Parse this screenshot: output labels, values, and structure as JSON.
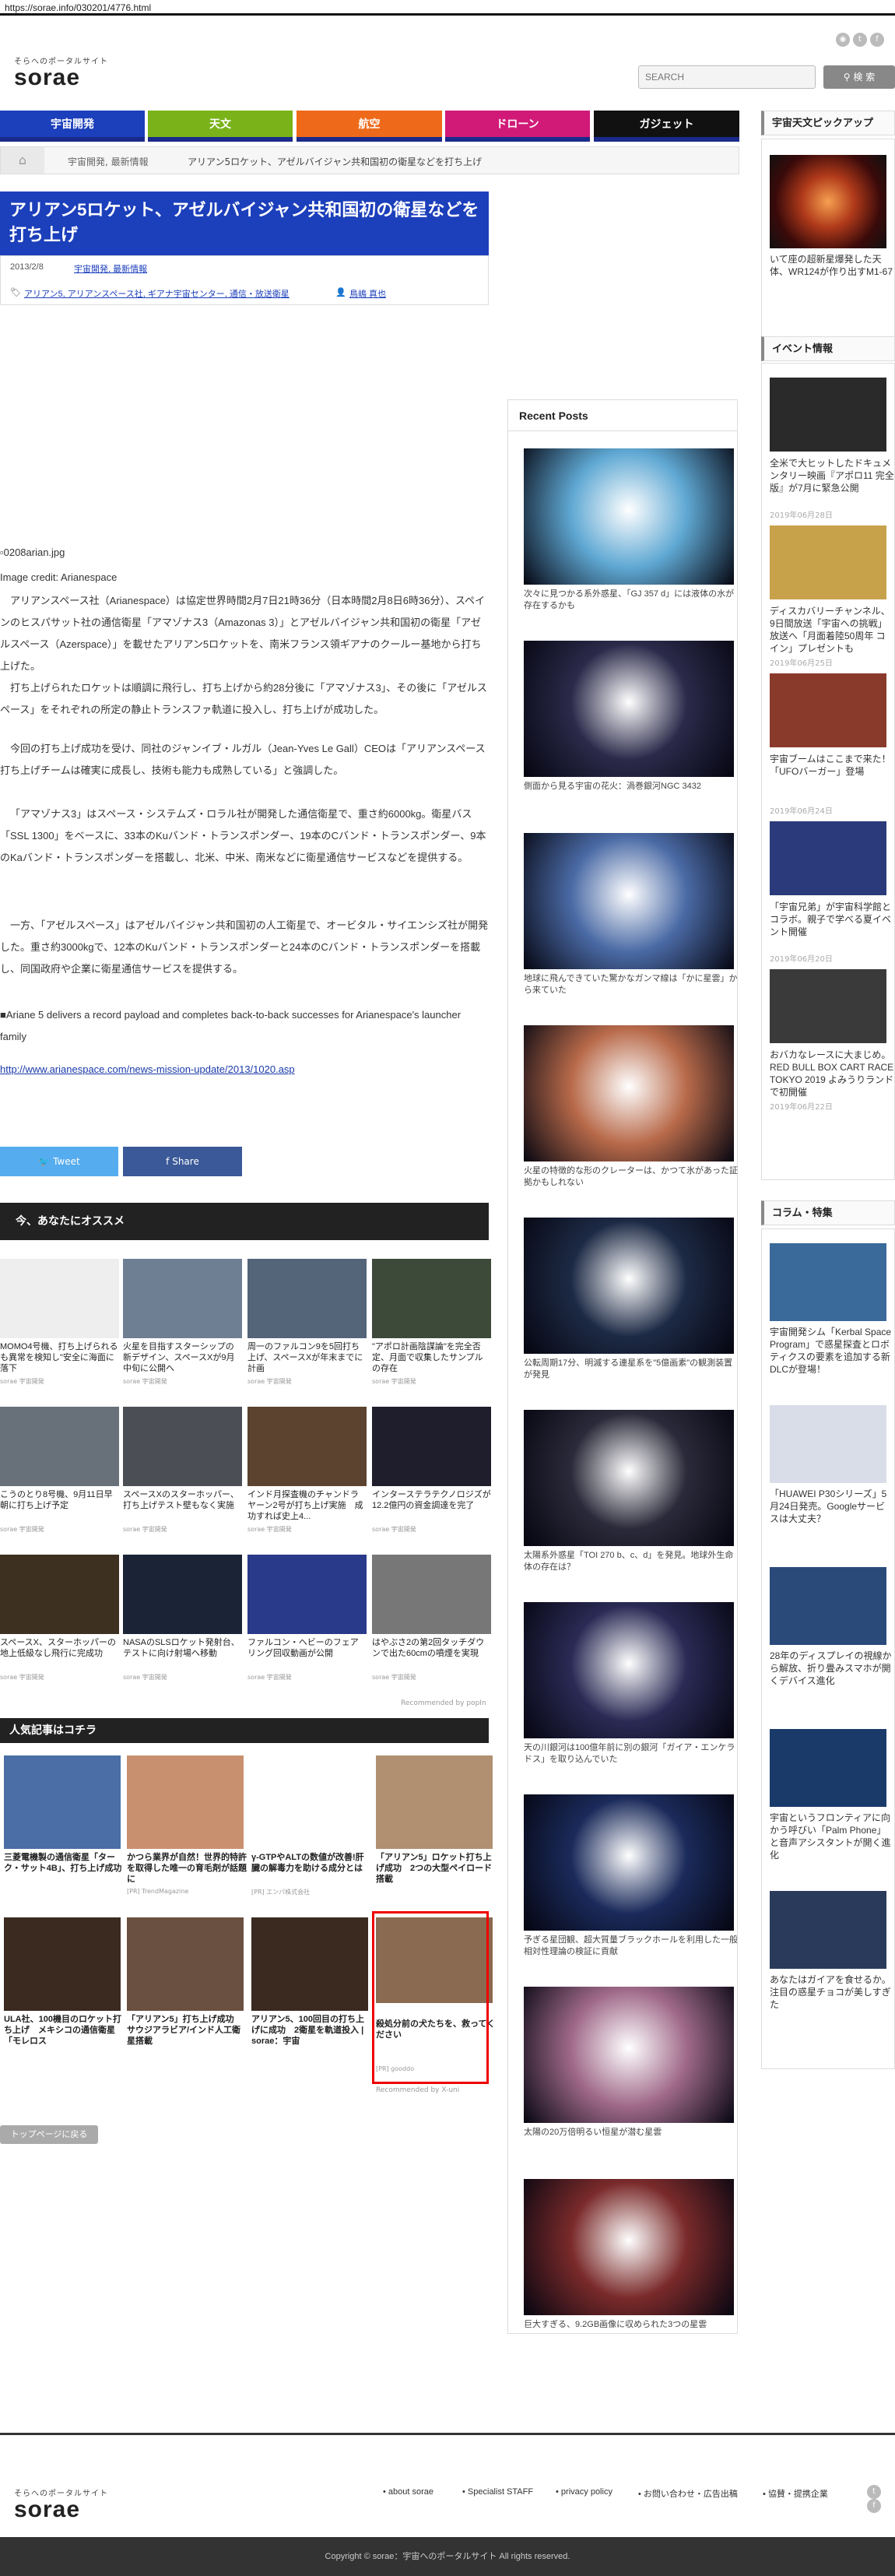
{
  "url": "https://sorae.info/030201/4776.html",
  "header": {
    "logo_small": "そらへのポータルサイト",
    "logo_big": "sorae",
    "search_placeholder": "SEARCH",
    "search_button": "検 索"
  },
  "nav": [
    {
      "label": "宇宙開発",
      "color": "#1c3fbb"
    },
    {
      "label": "天文",
      "color": "#7ab319"
    },
    {
      "label": "航空",
      "color": "#ee6a1a"
    },
    {
      "label": "ドローン",
      "color": "#d11a78"
    },
    {
      "label": "ガジェット",
      "color": "#111111"
    }
  ],
  "breadcrumb": {
    "cat": "宇宙開発, 最新情報",
    "current": "アリアン5ロケット、アゼルバイジャン共和国初の衛星などを打ち上げ"
  },
  "article": {
    "title": "アリアン5ロケット、アゼルバイジャン共和国初の衛星などを打ち上げ",
    "date": "2013/2/8",
    "categories": "宇宙開発, 最新情報",
    "tags": "アリアン5, アリアンスペース社, ギアナ宇宙センター, 通信・放送衛星",
    "author": "鳥嶋 真也",
    "img_alt": "0208arian.jpg",
    "credit": "Image credit: Arianespace",
    "p1": "アリアンスペース社（Arianespace）は協定世界時間2月7日21時36分（日本時間2月8日6時36分）、スペインのヒスパサット社の通信衛星「アマゾナス3（Amazonas 3）」とアゼルバイジャン共和国初の衛星「アゼルスペース（Azerspace）」を載せたアリアン5ロケットを、南米フランス領ギアナのクールー基地から打ち上げた。",
    "p2": "打ち上げられたロケットは順調に飛行し、打ち上げから約28分後に「アマゾナス3」、その後に「アゼルスペース」をそれぞれの所定の静止トランスファ軌道に投入し、打ち上げが成功した。",
    "p3": "今回の打ち上げ成功を受け、同社のジャンイブ・ルガル（Jean-Yves Le Gall）CEOは「アリアンスペース打ち上げチームは確実に成長し、技術も能力も成熟している」と強調した。",
    "p4": "「アマゾナス3」はスペース・システムズ・ロラル社が開発した通信衛星で、重さ約6000kg。衛星バス「SSL 1300」をベースに、33本のKuバンド・トランスポンダー、19本のCバンド・トランスポンダー、9本のKaバンド・トランスポンダーを搭載し、北米、中米、南米などに衛星通信サービスなどを提供する。",
    "p5": "一方、「アゼルスペース」はアゼルバイジャン共和国初の人工衛星で、オービタル・サイエンシズ社が開発した。重さ約3000kgで、12本のKuバンド・トランスポンダーと24本のCバンド・トランスポンダーを搭載し、同国政府や企業に衛星通信サービスを提供する。",
    "source": "■Ariane 5 delivers a record payload and completes back-to-back successes for Arianespace's launcher family",
    "link": "http://www.arianespace.com/news-mission-update/2013/1020.asp"
  },
  "share": {
    "tweet": "Tweet",
    "share": "Share"
  },
  "recommend": {
    "heading": "今、あなたにオススメ",
    "footer": "Recommended by",
    "brand": "popIn",
    "items": [
      {
        "title": "MOMO4号機、打ち上げられるも異常を検知し\"安全に海面に落下",
        "source": "sorae 宇宙開発",
        "bg": "#eeeeee"
      },
      {
        "title": "火星を目指すスターシップの新デザイン、スペースXが9月中旬に公開へ",
        "source": "sorae 宇宙開発",
        "bg": "#6e7f93"
      },
      {
        "title": "周一のファルコン9を5回打ち上げ、スペースXが年末までに計画",
        "source": "sorae 宇宙開発",
        "bg": "#54657a"
      },
      {
        "title": "\"アポロ計画陰謀論\"を完全否定、月面で収集したサンプルの存在",
        "source": "sorae 宇宙開発",
        "bg": "#3d4a3a"
      },
      {
        "title": "こうのとり8号機、9月11日早朝に打ち上げ予定",
        "source": "sorae 宇宙開発",
        "bg": "#68707a"
      },
      {
        "title": "スペースXのスターホッパー、打ち上げテスト壁もなく実施",
        "source": "sorae 宇宙開発",
        "bg": "#4b4f55"
      },
      {
        "title": "インド月探査機のチャンドラヤーン2号が打ち上げ実施　成功すれば史上4...",
        "source": "sorae 宇宙開発",
        "bg": "#5b4330"
      },
      {
        "title": "インターステラテクノロジズが12.2億円の資金調達を完了",
        "source": "sorae 宇宙開発",
        "bg": "#1e1e2c"
      },
      {
        "title": "スペースX、スターホッパーの地上低級なし飛行に完成功",
        "source": "sorae 宇宙開発",
        "bg": "#3d3020"
      },
      {
        "title": "NASAのSLSロケット発射台、テストに向け射場へ移動",
        "source": "sorae 宇宙開発",
        "bg": "#1b2436"
      },
      {
        "title": "ファルコン・ヘビーのフェアリング回収動画が公開",
        "source": "sorae 宇宙開発",
        "bg": "#2a3a8a"
      },
      {
        "title": "はやぶさ2の第2回タッチダウンで出た60cmの噴煙を実現",
        "source": "sorae 宇宙開発",
        "bg": "#777777"
      }
    ]
  },
  "popular": {
    "heading": "人気記事はコチラ",
    "footer": "Recommended by",
    "brand": "X-uni",
    "items": [
      {
        "title": "三菱電機製の通信衛星「ターク・サット4B」、打ち上げ成功",
        "source": "",
        "bg": "#4a6ea5"
      },
      {
        "title": "かつら業界が自然！世界的特許を取得した唯一の育毛剤が話題に",
        "source": "[PR] TrendMagazine",
        "bg": "#c99070"
      },
      {
        "title": "γ-GTPやALTの数値が改善!肝臓の解毒力を助ける成分とは",
        "source": "[PR] エンパ株式会社",
        "bg": "#ffffff"
      },
      {
        "title": "「アリアン5」ロケット打ち上げ成功　2つの大型ペイロード搭載",
        "source": "",
        "bg": "#b09070"
      },
      {
        "title": "ULA社、100機目のロケット打ち上げ　メキシコの通信衛星「モレロス",
        "source": "",
        "bg": "#3a2a20"
      },
      {
        "title": "「アリアン5」打ち上げ成功　サウジアラビア/インド人工衛星搭載",
        "source": "",
        "bg": "#6a5040"
      },
      {
        "title": "アリアン5、100回目の打ち上げに成功　2衛星を軌道投入 | sorae：宇宙",
        "source": "",
        "bg": "#3a2a20"
      },
      {
        "title": "殺処分前の犬たちを、救ってください",
        "source": "[PR] gooddo",
        "bg": "#8a6a50"
      }
    ]
  },
  "top_button": "トップページに戻る",
  "recent_posts": {
    "heading": "Recent Posts",
    "items": [
      {
        "title": "次々に見つかる系外惑星、「GJ 357 d」には液体の水が存在するかも",
        "bg": "#5fa8d3"
      },
      {
        "title": "側面から見る宇宙の花火：渦巻銀河NGC 3432",
        "bg": "#2b2a4a"
      },
      {
        "title": "地球に飛んできていた驚かなガンマ線は「かに星雲」から来ていた",
        "bg": "#4a6aa5"
      },
      {
        "title": "火星の特徴的な形のクレーターは、かつて氷があった証拠かもしれない",
        "bg": "#b86a4a"
      },
      {
        "title": "公転周期17分、明滅する連星系を\"5億画素\"の観測装置が発見",
        "bg": "#1d2a45"
      },
      {
        "title": "太陽系外惑星「TOI 270 b、c、d」を発見。地球外生命体の存在は？",
        "bg": "#2a2a3a"
      },
      {
        "title": "天の川銀河は100億年前に別の銀河「ガイア・エンケラドス」を取り込んでいた",
        "bg": "#2a2a55"
      },
      {
        "title": "予ぎる星団観、超大質量ブラックホールを利用した一般相対性理論の検証に貢献",
        "bg": "#1a2a5a"
      },
      {
        "title": "太陽の20万倍明るい恒星が潜む星雲",
        "bg": "#a06a8a"
      },
      {
        "title": "巨大すぎる、9.2GB画像に収められた3つの星雲",
        "bg": "#7a2a2a"
      }
    ]
  },
  "sidebar": {
    "pickup_heading": "宇宙天文ピックアップ",
    "pickup": {
      "title": "いて座の超新星爆発した天体、WR124が作り出すM1-67",
      "bg": "#7a2a1a"
    },
    "event_heading": "イベント情報",
    "events": [
      {
        "title": "全米で大ヒットしたドキュメンタリー映画『アポロ11 完全版』が7月に緊急公開",
        "date": "2019年06月28日",
        "bg": "#2a2a2a"
      },
      {
        "title": "ディスカバリーチャンネル、9日間放送「宇宙への挑戦」放送へ「月面着陸50周年 コイン」プレゼントも",
        "date": "2019年06月25日",
        "bg": "#c7a24a"
      },
      {
        "title": "宇宙ブームはここまで来た！「UFOバーガー」登場",
        "date": "2019年06月24日",
        "bg": "#8a3a2a"
      },
      {
        "title": "「宇宙兄弟」が宇宙科学館とコラボ。親子で学べる夏イベント開催",
        "date": "2019年06月20日",
        "bg": "#2a3a7a"
      },
      {
        "title": "おバカなレースに大まじめ。RED BULL BOX CART RACE TOKYO 2019 よみうりランドで初開催",
        "date": "2019年06月22日",
        "bg": "#3a3a3a"
      }
    ],
    "column_heading": "コラム・特集",
    "columns": [
      {
        "title": "宇宙開発シム「Kerbal Space Program」で惑星探査とロボティクスの要素を追加する新DLCが登場！",
        "bg": "#3a6a9a"
      },
      {
        "title": "「HUAWEI P30シリーズ」5月24日発売。Googleサービスは大丈夫？",
        "bg": "#d8dde8"
      },
      {
        "title": "28年のディスプレイの視線から解放、折り畳みスマホが開くデバイス進化",
        "bg": "#2a4a7a"
      },
      {
        "title": "宇宙というフロンティアに向かう呼びい「Palm Phone」と音声アシスタントが開く進化",
        "bg": "#1a3a6a"
      },
      {
        "title": "あなたはガイアを食せるか。注目の惑星チョコが美しすぎた",
        "bg": "#2a3a5a"
      }
    ]
  },
  "footer": {
    "logo_small": "そらへのポータルサイト",
    "logo_big": "sorae",
    "links": [
      "about sorae",
      "Specialist STAFF",
      "privacy policy",
      "お問い合わせ・広告出稿",
      "協賛・提携企業"
    ],
    "copyright": "Copyright © sorae：宇宙へのポータルサイト All rights reserved."
  }
}
